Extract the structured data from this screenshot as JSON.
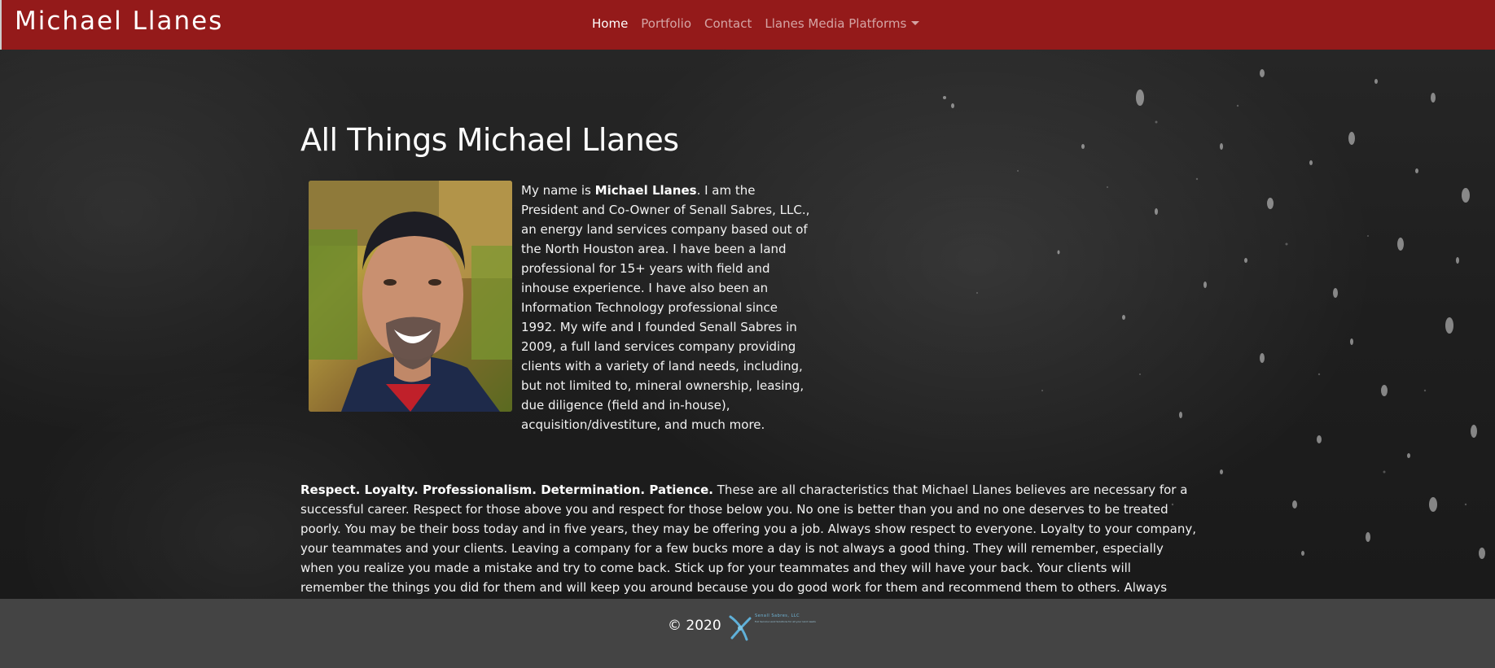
{
  "navbar": {
    "brand": "Michael Llanes",
    "items": [
      {
        "label": "Home",
        "active": true
      },
      {
        "label": "Portfolio",
        "active": false
      },
      {
        "label": "Contact",
        "active": false
      },
      {
        "label": "Llanes Media Platforms",
        "active": false,
        "dropdown": true
      }
    ]
  },
  "main": {
    "title": "All Things Michael Llanes",
    "bio_lead": "My name is ",
    "bio_name": "Michael Llanes",
    "bio_text": ". I am the President and Co-Owner of Senall Sabres, LLC., an energy land services company based out of the North Houston area. I have been a land professional for 15+ years with field and inhouse experience. I have also been an Information Technology professional since 1992. My wife and I founded Senall Sabres in 2009, a full land services company providing clients with a variety of land needs, including, but not limited to, mineral ownership, leasing, due diligence (field and in-house), acquisition/divestiture, and much more.",
    "values_bold": "Respect. Loyalty. Professionalism. Determination. Patience.",
    "values_text": " These are all characteristics that Michael Llanes believes are necessary for a successful career. Respect for those above you and respect for those below you. No one is better than you and no one deserves to be treated poorly. You may be their boss today and in five years, they may be offering you a job. Always show respect to everyone. Loyalty to your company, your teammates and your clients. Leaving a company for a few bucks more a day is not always a good thing. They will remember, especially when you realize you made a mistake and try to come back. Stick up for your teammates and they will have your back. Your clients will remember the things you did for them and will keep you around because you do good work for them and recommend them to others. Always carry yourself in a dignified, professional manner. You represent yourself and your company at all times. Work and behave in a way that others will believe you to be reliable, competent, mature and respectful. Work can be tough and"
  },
  "footer": {
    "copyright": "© 2020",
    "logo_name": "Senall Sabres, LLC",
    "logo_tagline": "Full Service Land Solutions for all your land needs"
  },
  "colors": {
    "navbar": "#941a1a",
    "footer": "#444444",
    "logo": "#6fb6d8"
  }
}
